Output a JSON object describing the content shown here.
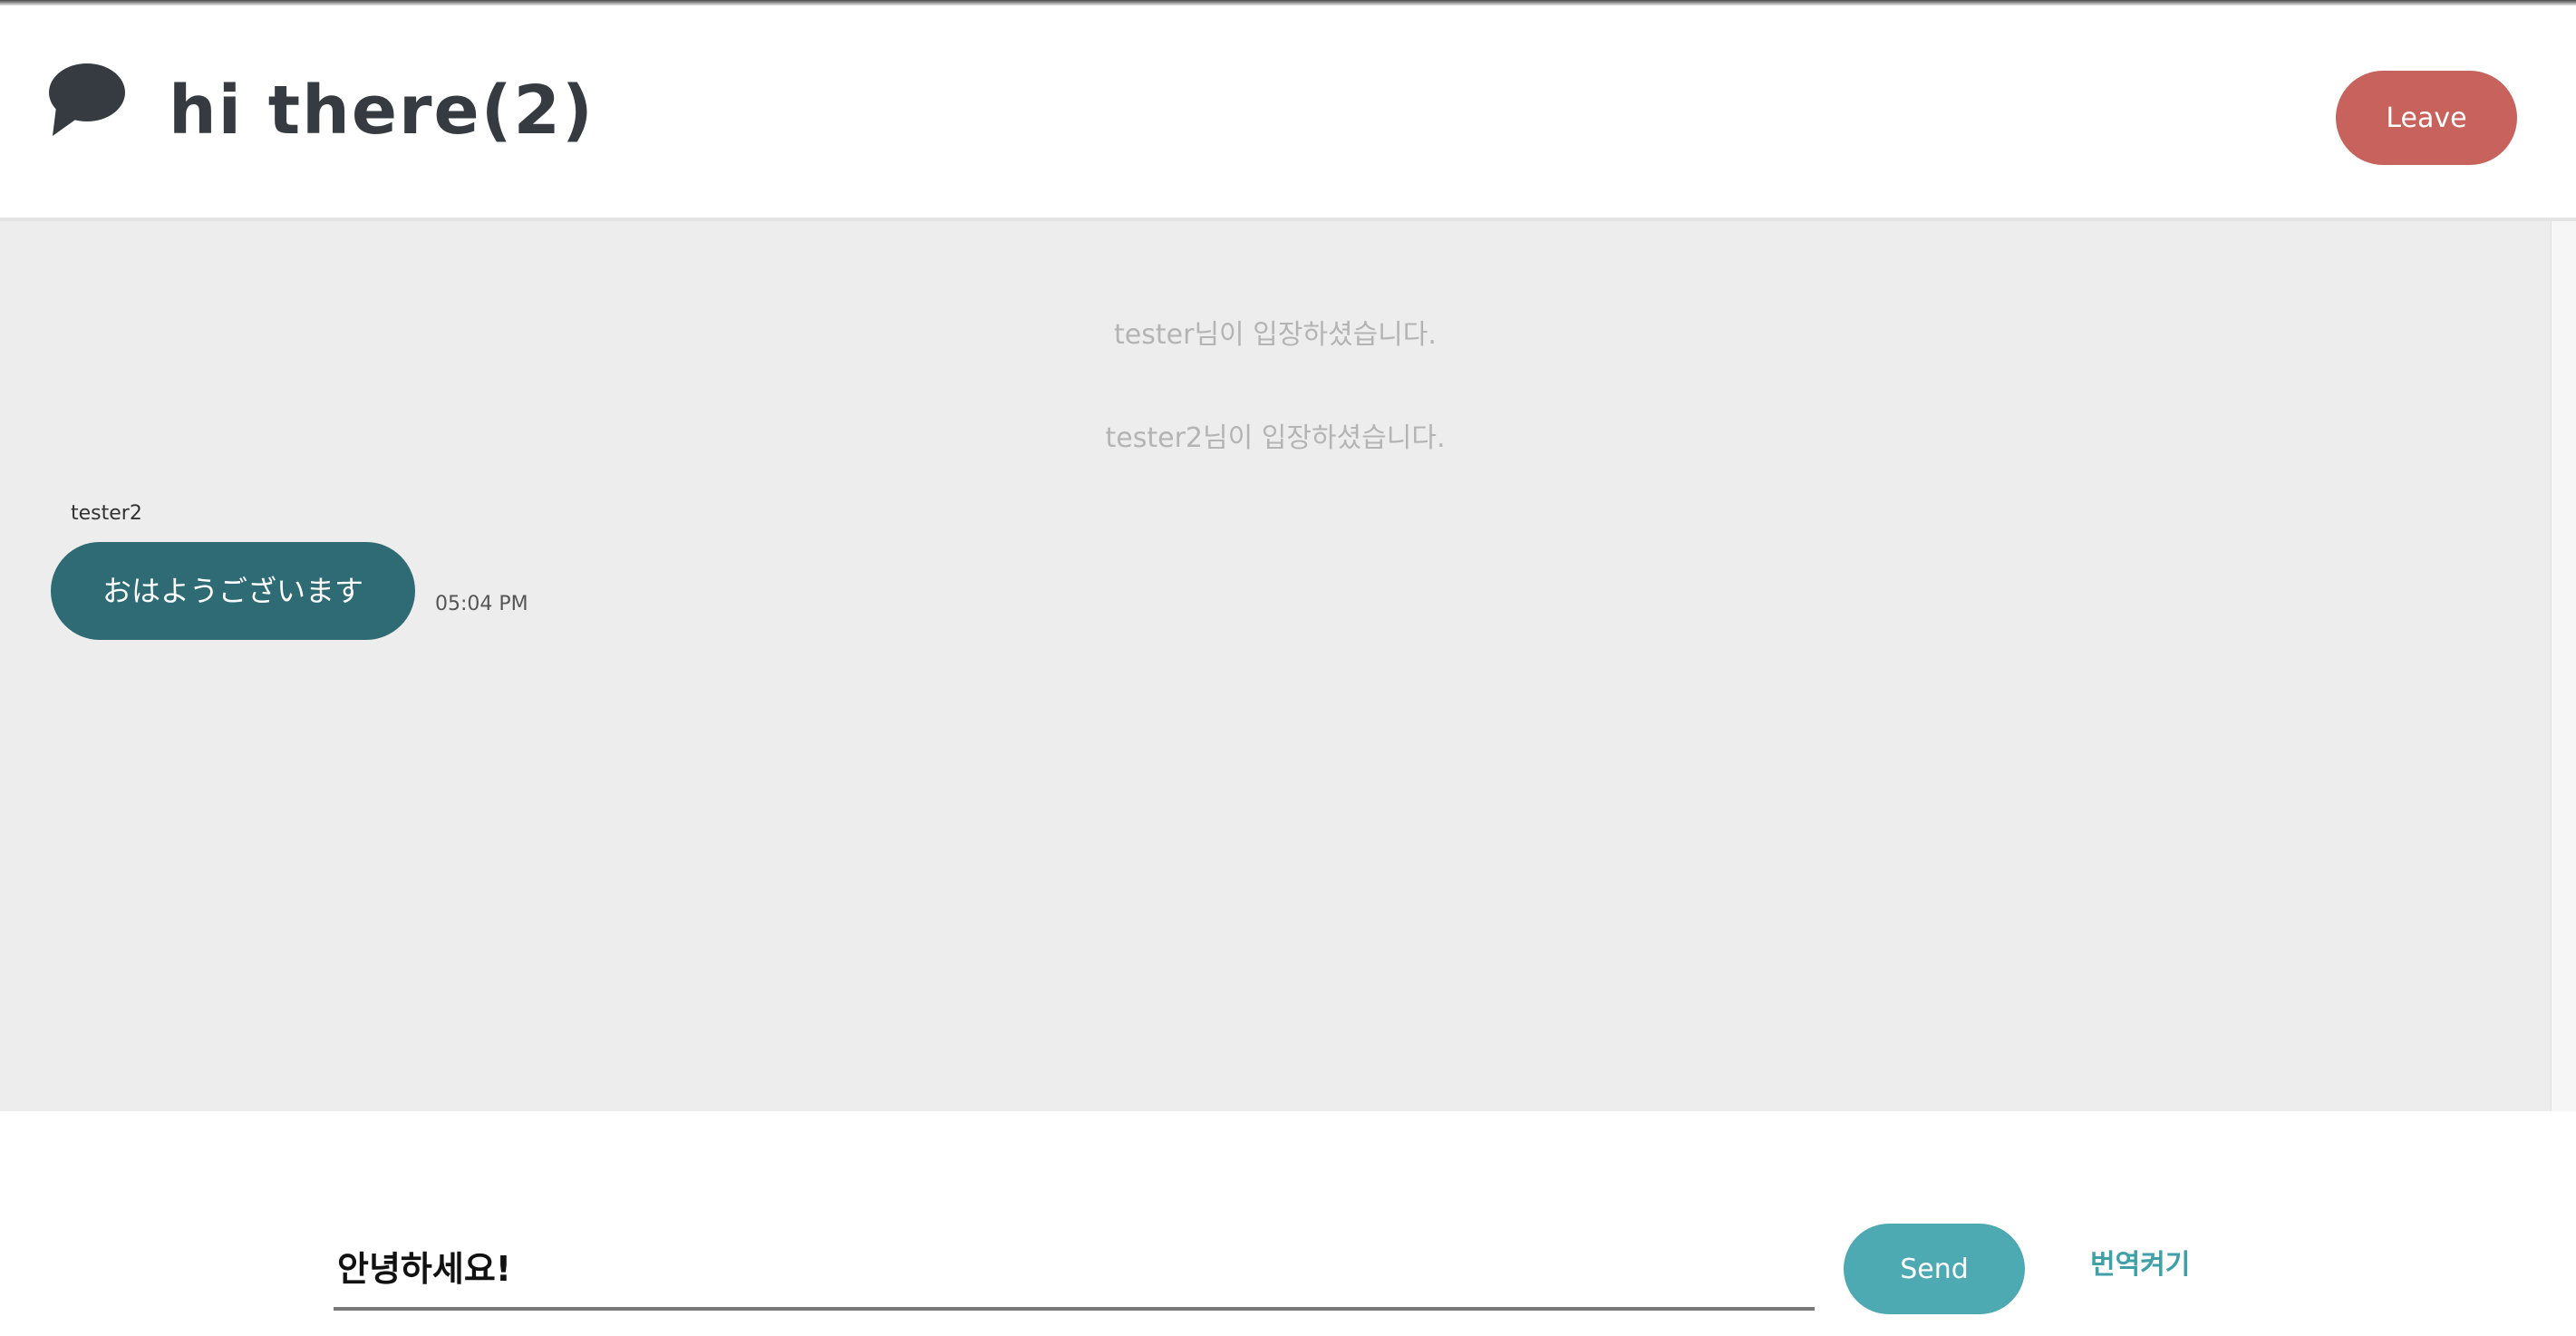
{
  "header": {
    "icon": "speech-bubble-icon",
    "title": "hi there(2)",
    "leave_label": "Leave"
  },
  "chat": {
    "system_messages": [
      "tester님이 입장하셨습니다.",
      "tester2님이 입장하셨습니다."
    ],
    "messages": [
      {
        "sender": "tester2",
        "text": "おはようございます",
        "time": "05:04 PM"
      }
    ]
  },
  "composer": {
    "input_value": "안녕하세요!",
    "send_label": "Send",
    "translate_label": "번역켜기"
  },
  "colors": {
    "leave": "#c7625c",
    "bubble": "#2e6b74",
    "send": "#4eaab2",
    "translate": "#3fa0a8",
    "chat_bg": "#ededed",
    "title": "#363b42"
  }
}
